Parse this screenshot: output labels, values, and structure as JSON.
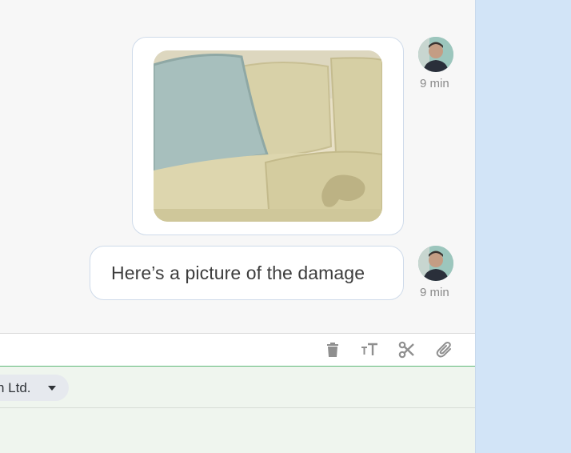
{
  "messages": [
    {
      "type": "image",
      "image_description": "photo of a beige sofa with a light blue cushion and a stain on the seat",
      "timestamp": "9 min"
    },
    {
      "type": "text",
      "text": "Here’s a picture of the damage",
      "timestamp": "9 min"
    }
  ],
  "composer": {
    "toolbar_icons": [
      "trash-icon",
      "text-size-icon",
      "scissors-icon",
      "paperclip-icon"
    ],
    "sender_selector": "h Ltd."
  },
  "colors": {
    "right_panel": "#d2e4f7",
    "composer_border": "#5fb879",
    "composer_body": "#eff5ee"
  }
}
